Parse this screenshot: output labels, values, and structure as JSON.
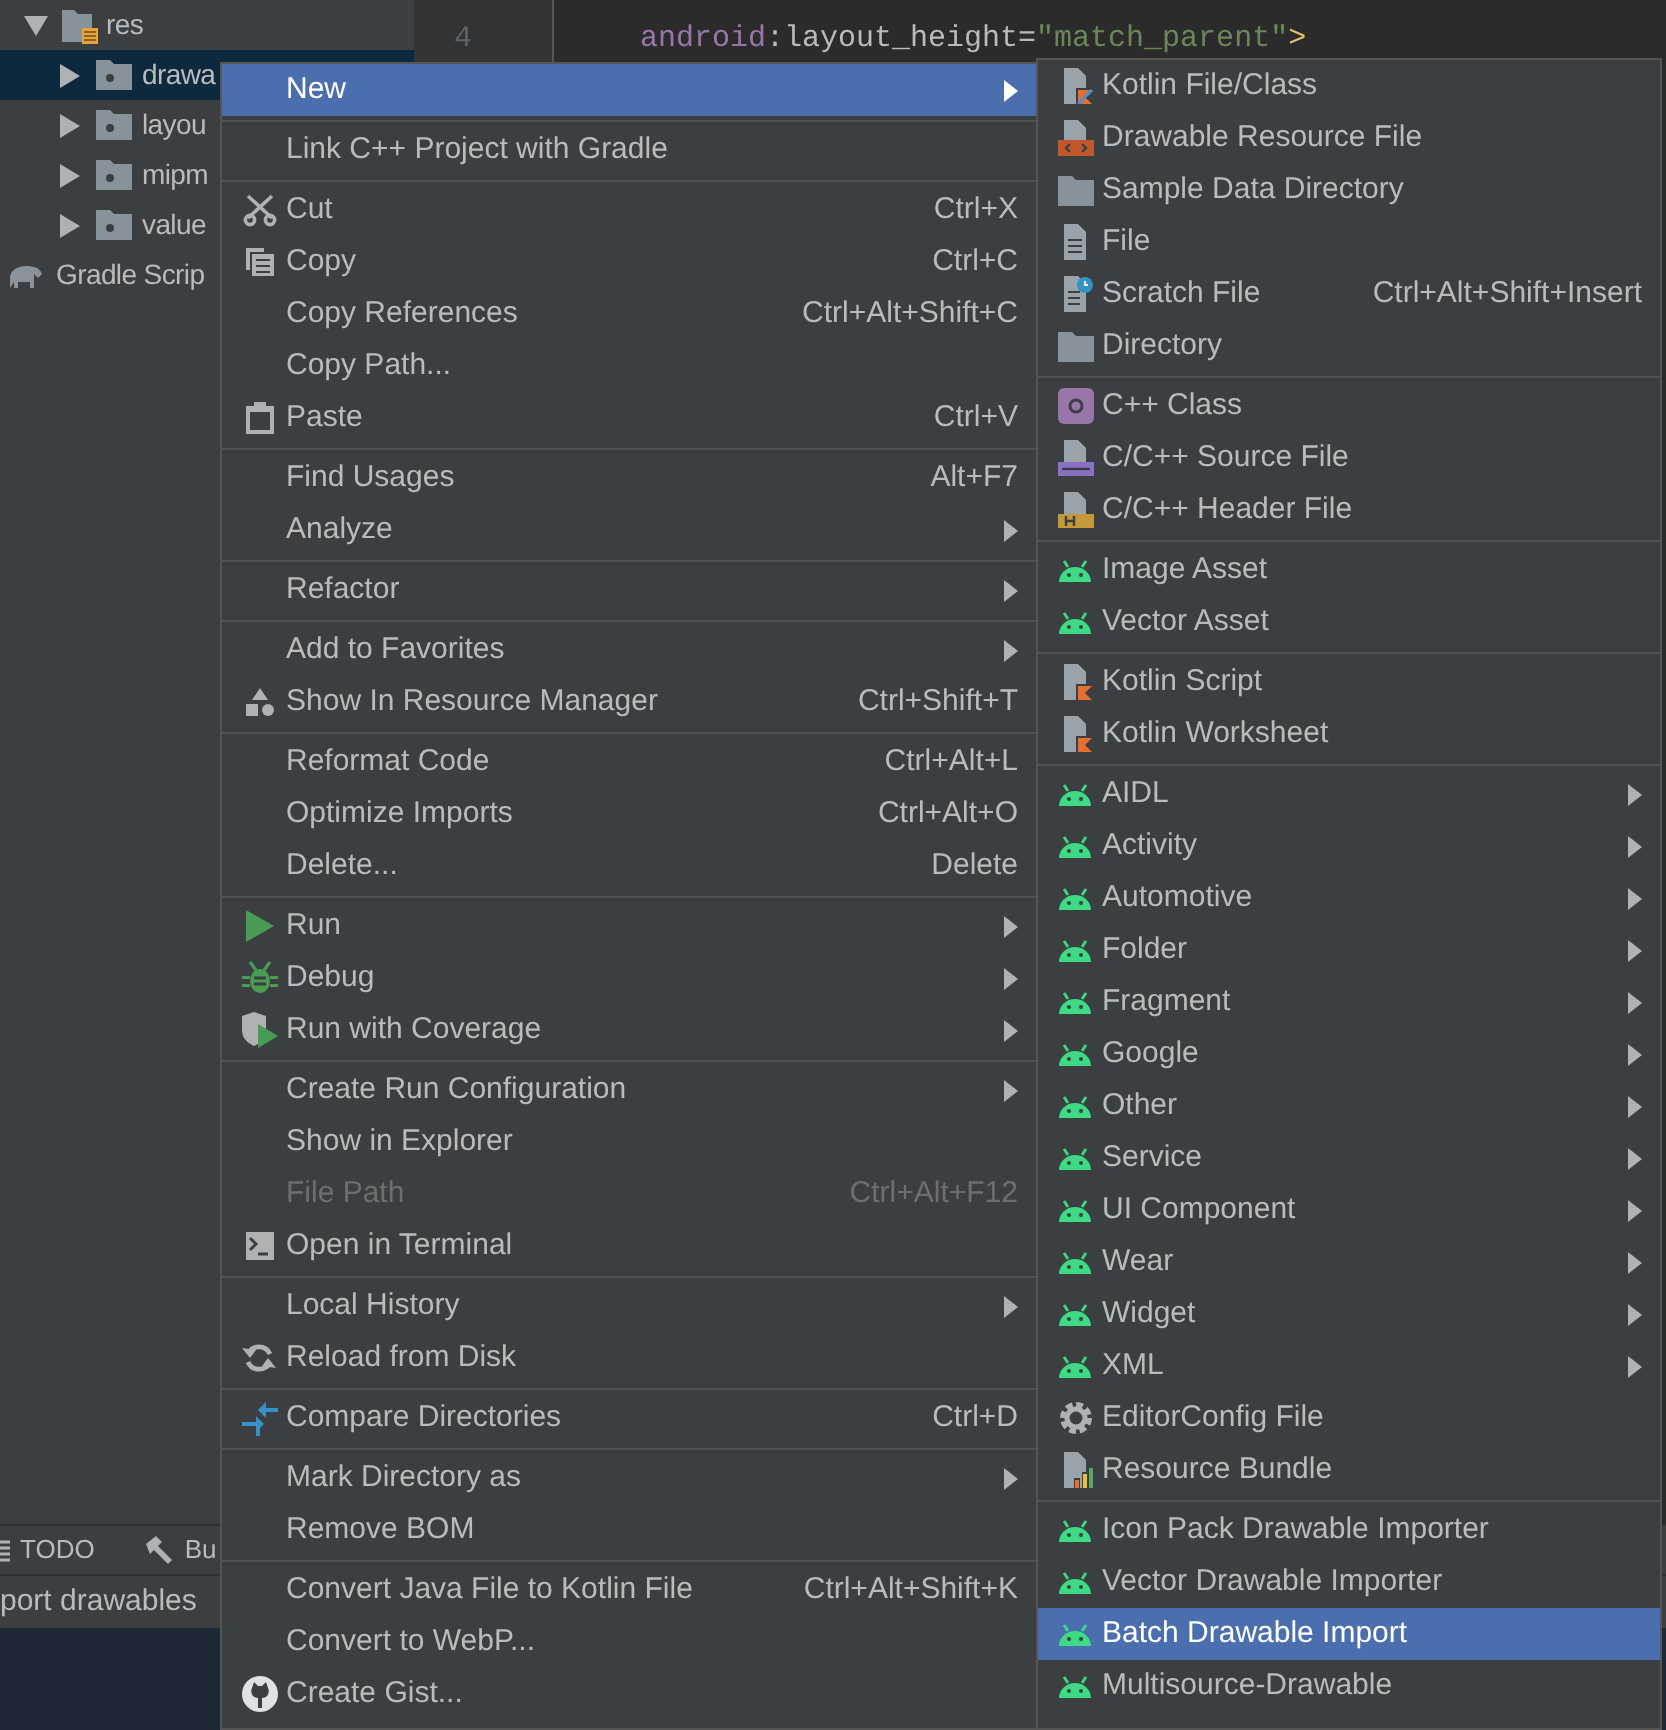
{
  "project_tree": [
    {
      "label": "res",
      "expanded": true,
      "selected": false,
      "children": [
        {
          "label": "drawa",
          "expanded": false,
          "selected": true
        },
        {
          "label": "layou",
          "expanded": false,
          "selected": false
        },
        {
          "label": "mipm",
          "expanded": false,
          "selected": false
        },
        {
          "label": "value",
          "expanded": false,
          "selected": false
        }
      ]
    },
    {
      "label": "Gradle Scrip",
      "selected": false
    }
  ],
  "editor": {
    "line_number": "4",
    "code": [
      {
        "kind": "namespace",
        "text": "android"
      },
      {
        "kind": "attribute",
        "text": ":layout_height="
      },
      {
        "kind": "string",
        "text": "\"match_parent\""
      },
      {
        "kind": "bracket",
        "text": ">"
      }
    ]
  },
  "tool_tabs": [
    {
      "label": "TODO"
    },
    {
      "label": "Bu"
    }
  ],
  "status_text": "port drawables",
  "context_menu": {
    "groups": [
      {
        "items": [
          {
            "label": "New",
            "selected": true,
            "submenu": true,
            "disabled": false
          }
        ]
      },
      {
        "items": [
          {
            "label": "Link C++ Project with Gradle",
            "selected": false,
            "submenu": false,
            "disabled": false
          }
        ]
      },
      {
        "items": [
          {
            "label": "Cut",
            "shortcut": "Ctrl+X",
            "selected": false,
            "submenu": false,
            "disabled": false
          },
          {
            "label": "Copy",
            "shortcut": "Ctrl+C",
            "selected": false,
            "submenu": false,
            "disabled": false
          },
          {
            "label": "Copy References",
            "shortcut": "Ctrl+Alt+Shift+C",
            "selected": false,
            "submenu": false,
            "disabled": false
          },
          {
            "label": "Copy Path...",
            "selected": false,
            "submenu": false,
            "disabled": false
          },
          {
            "label": "Paste",
            "shortcut": "Ctrl+V",
            "selected": false,
            "submenu": false,
            "disabled": false
          }
        ]
      },
      {
        "items": [
          {
            "label": "Find Usages",
            "shortcut": "Alt+F7",
            "selected": false,
            "submenu": false,
            "disabled": false
          },
          {
            "label": "Analyze",
            "selected": false,
            "submenu": true,
            "disabled": false
          }
        ]
      },
      {
        "items": [
          {
            "label": "Refactor",
            "selected": false,
            "submenu": true,
            "disabled": false
          }
        ]
      },
      {
        "items": [
          {
            "label": "Add to Favorites",
            "selected": false,
            "submenu": true,
            "disabled": false
          },
          {
            "label": "Show In Resource Manager",
            "shortcut": "Ctrl+Shift+T",
            "selected": false,
            "submenu": false,
            "disabled": false
          }
        ]
      },
      {
        "items": [
          {
            "label": "Reformat Code",
            "shortcut": "Ctrl+Alt+L",
            "selected": false,
            "submenu": false,
            "disabled": false
          },
          {
            "label": "Optimize Imports",
            "shortcut": "Ctrl+Alt+O",
            "selected": false,
            "submenu": false,
            "disabled": false
          },
          {
            "label": "Delete...",
            "shortcut": "Delete",
            "selected": false,
            "submenu": false,
            "disabled": false
          }
        ]
      },
      {
        "items": [
          {
            "label": "Run",
            "selected": false,
            "submenu": true,
            "disabled": false
          },
          {
            "label": "Debug",
            "selected": false,
            "submenu": true,
            "disabled": false
          },
          {
            "label": "Run with Coverage",
            "selected": false,
            "submenu": true,
            "disabled": false
          }
        ]
      },
      {
        "items": [
          {
            "label": "Create Run Configuration",
            "selected": false,
            "submenu": true,
            "disabled": false
          },
          {
            "label": "Show in Explorer",
            "selected": false,
            "submenu": false,
            "disabled": false
          },
          {
            "label": "File Path",
            "shortcut": "Ctrl+Alt+F12",
            "selected": false,
            "submenu": false,
            "disabled": true
          },
          {
            "label": "Open in Terminal",
            "selected": false,
            "submenu": false,
            "disabled": false
          }
        ]
      },
      {
        "items": [
          {
            "label": "Local History",
            "selected": false,
            "submenu": true,
            "disabled": false
          },
          {
            "label": "Reload from Disk",
            "selected": false,
            "submenu": false,
            "disabled": false
          }
        ]
      },
      {
        "items": [
          {
            "label": "Compare Directories",
            "shortcut": "Ctrl+D",
            "selected": false,
            "submenu": false,
            "disabled": false
          }
        ]
      },
      {
        "items": [
          {
            "label": "Mark Directory as",
            "selected": false,
            "submenu": true,
            "disabled": false
          },
          {
            "label": "Remove BOM",
            "selected": false,
            "submenu": false,
            "disabled": false
          }
        ]
      },
      {
        "items": [
          {
            "label": "Convert Java File to Kotlin File",
            "shortcut": "Ctrl+Alt+Shift+K",
            "selected": false,
            "submenu": false,
            "disabled": false
          },
          {
            "label": "Convert to WebP...",
            "selected": false,
            "submenu": false,
            "disabled": false
          },
          {
            "label": "Create Gist...",
            "selected": false,
            "submenu": false,
            "disabled": false
          }
        ]
      }
    ]
  },
  "new_submenu": {
    "groups": [
      {
        "items": [
          {
            "label": "Kotlin File/Class",
            "selected": false,
            "submenu": false
          },
          {
            "label": "Drawable Resource File",
            "selected": false,
            "submenu": false
          },
          {
            "label": "Sample Data Directory",
            "selected": false,
            "submenu": false
          },
          {
            "label": "File",
            "selected": false,
            "submenu": false
          },
          {
            "label": "Scratch File",
            "shortcut": "Ctrl+Alt+Shift+Insert",
            "selected": false,
            "submenu": false
          },
          {
            "label": "Directory",
            "selected": false,
            "submenu": false
          }
        ]
      },
      {
        "items": [
          {
            "label": "C++ Class",
            "selected": false,
            "submenu": false
          },
          {
            "label": "C/C++ Source File",
            "selected": false,
            "submenu": false
          },
          {
            "label": "C/C++ Header File",
            "selected": false,
            "submenu": false
          }
        ]
      },
      {
        "items": [
          {
            "label": "Image Asset",
            "selected": false,
            "submenu": false
          },
          {
            "label": "Vector Asset",
            "selected": false,
            "submenu": false
          }
        ]
      },
      {
        "items": [
          {
            "label": "Kotlin Script",
            "selected": false,
            "submenu": false
          },
          {
            "label": "Kotlin Worksheet",
            "selected": false,
            "submenu": false
          }
        ]
      },
      {
        "items": [
          {
            "label": "AIDL",
            "selected": false,
            "submenu": true
          },
          {
            "label": "Activity",
            "selected": false,
            "submenu": true
          },
          {
            "label": "Automotive",
            "selected": false,
            "submenu": true
          },
          {
            "label": "Folder",
            "selected": false,
            "submenu": true
          },
          {
            "label": "Fragment",
            "selected": false,
            "submenu": true
          },
          {
            "label": "Google",
            "selected": false,
            "submenu": true
          },
          {
            "label": "Other",
            "selected": false,
            "submenu": true
          },
          {
            "label": "Service",
            "selected": false,
            "submenu": true
          },
          {
            "label": "UI Component",
            "selected": false,
            "submenu": true
          },
          {
            "label": "Wear",
            "selected": false,
            "submenu": true
          },
          {
            "label": "Widget",
            "selected": false,
            "submenu": true
          },
          {
            "label": "XML",
            "selected": false,
            "submenu": true
          },
          {
            "label": "EditorConfig File",
            "selected": false,
            "submenu": false
          },
          {
            "label": "Resource Bundle",
            "selected": false,
            "submenu": false
          }
        ]
      },
      {
        "items": [
          {
            "label": "Icon Pack Drawable Importer",
            "selected": false,
            "submenu": false
          },
          {
            "label": "Vector Drawable Importer",
            "selected": false,
            "submenu": false
          },
          {
            "label": "Batch Drawable Import",
            "selected": true,
            "submenu": false
          },
          {
            "label": "Multisource-Drawable",
            "selected": false,
            "submenu": false
          }
        ]
      }
    ]
  }
}
